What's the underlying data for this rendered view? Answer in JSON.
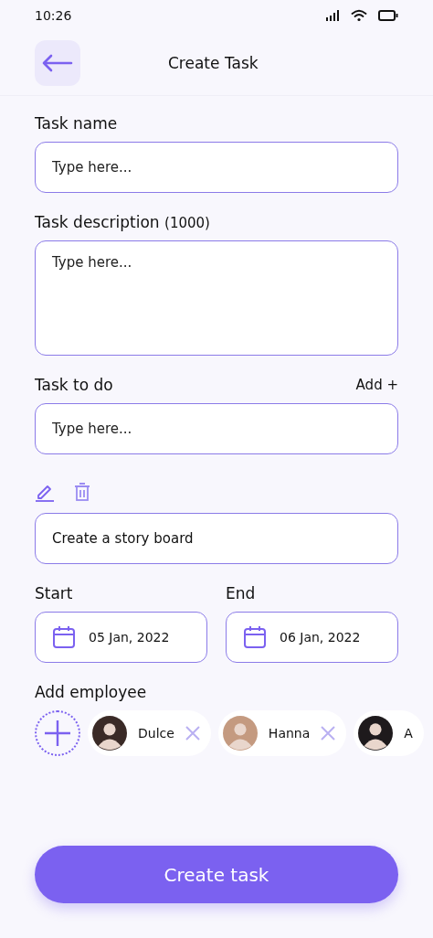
{
  "status_bar": {
    "time": "10:26"
  },
  "header": {
    "title": "Create Task"
  },
  "task_name": {
    "label": "Task name",
    "placeholder": "Type here..."
  },
  "task_description": {
    "label": "Task description",
    "counter": "(1000)",
    "placeholder": "Type here..."
  },
  "task_to_do": {
    "label": "Task to do",
    "add_link": "Add +",
    "placeholder": "Type here..."
  },
  "todo_items": [
    {
      "text": "Create a story board"
    }
  ],
  "start": {
    "label": "Start",
    "value": "05 Jan, 2022"
  },
  "end": {
    "label": "End",
    "value": "06 Jan, 2022"
  },
  "employees": {
    "label": "Add employee",
    "items": [
      {
        "name": "Dulce",
        "removable": true,
        "color": "#3a2a26"
      },
      {
        "name": "Hanna",
        "removable": true,
        "color": "#c49a80"
      },
      {
        "name": "A",
        "removable": false,
        "color": "#1e1a1c"
      }
    ]
  },
  "submit": {
    "label": "Create task"
  }
}
